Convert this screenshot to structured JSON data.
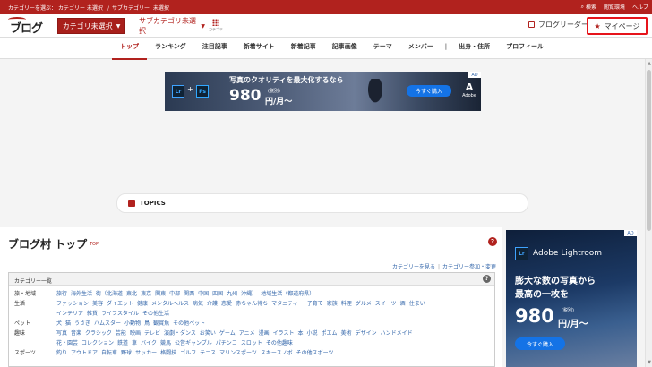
{
  "topbar": {
    "cat_prefix": "カテゴリーを選ぶ：",
    "cat_label": "カテゴリー 未選択",
    "subcat_prefix": "サブカテゴリー",
    "subcat_label": "未選択",
    "search": "検索",
    "reading_settings": "閲覧環境",
    "help": "ヘルプ"
  },
  "header": {
    "logo": "ブログ村",
    "category_select": "カテゴリ未選択",
    "subcategory_select": "サブカテゴリ未選択",
    "category_grid_label": "カテゴリ",
    "blog_reader": "ブログリーダー",
    "mypage": "マイページ"
  },
  "nav": {
    "items": [
      "トップ",
      "ランキング",
      "注目記事",
      "新着サイト",
      "新着記事",
      "記事画像",
      "テーマ",
      "メンバー",
      "|",
      "出身・住所",
      "プロフィール"
    ],
    "active_index": 0
  },
  "banner1": {
    "lr": "Lr",
    "plus": "+",
    "ps": "Ps",
    "headline": "写真のクオリティを最大化するなら",
    "price": "980",
    "tax": "(税別)",
    "unit": "円/月〜",
    "button": "今すぐ購入",
    "adobe": "Adobe",
    "adchoice": "AD"
  },
  "topics": {
    "label": "TOPICS"
  },
  "main": {
    "title": "ブログ村 トップ",
    "title_sub": "TOP",
    "help": "?",
    "link_view": "カテゴリーを見る",
    "link_join": "カテゴリー参加・変更",
    "list_title": "カテゴリー一覧",
    "rows": [
      {
        "label": "旅・地域",
        "values": [
          "旅行",
          "海外生活",
          "街（北海道",
          "東北",
          "東京",
          "関東",
          "中部",
          "関西",
          "中国",
          "四国",
          "九州",
          "沖縄）",
          "地域生活（都道府県）"
        ]
      },
      {
        "label": "生活",
        "values": [
          "ファッション",
          "美容",
          "ダイエット",
          "健康",
          "メンタルヘルス",
          "病気",
          "介護",
          "恋愛",
          "赤ちゃん待ち",
          "マタニティー",
          "子育て",
          "家族",
          "料理",
          "グルメ",
          "スイーツ",
          "酒",
          "住まい"
        ]
      },
      {
        "label": "",
        "values": [
          "インテリア",
          "雑貨",
          "ライフスタイル",
          "その他生活"
        ]
      },
      {
        "label": "ペット",
        "values": [
          "犬",
          "猫",
          "うさぎ",
          "ハムスター",
          "小動物",
          "鳥",
          "観賞魚",
          "その他ペット"
        ]
      },
      {
        "label": "趣味",
        "values": [
          "写真",
          "音楽",
          "クラシック",
          "芸能",
          "映画",
          "テレビ",
          "演劇・ダンス",
          "お笑い",
          "ゲーム",
          "アニメ",
          "漫画",
          "イラスト",
          "本",
          "小説",
          "ポエム",
          "美術",
          "デザイン",
          "ハンドメイド"
        ]
      },
      {
        "label": "",
        "values": [
          "花・園芸",
          "コレクション",
          "鉄道",
          "車",
          "バイク",
          "競馬",
          "公営ギャンブル",
          "パチンコ",
          "スロット",
          "その他趣味"
        ]
      },
      {
        "label": "スポーツ",
        "values": [
          "釣り",
          "アウトドア",
          "自転車",
          "野球",
          "サッカー",
          "格闘技",
          "ゴルフ",
          "テニス",
          "マリンスポーツ",
          "スキースノボ",
          "その他スポーツ"
        ]
      }
    ]
  },
  "ad2": {
    "lr": "Lr",
    "brand": "Adobe Lightroom",
    "copy1": "膨大な数の写真から",
    "copy2": "最高の一枚を",
    "price": "980",
    "tax": "(税別)",
    "unit": "円/月〜",
    "button": "今すぐ購入",
    "adchoice": "AD"
  },
  "colors": {
    "brand_red": "#b1221e",
    "highlight_red": "#e6141b",
    "link_blue": "#3366aa",
    "adobe_blue": "#1473e6"
  }
}
